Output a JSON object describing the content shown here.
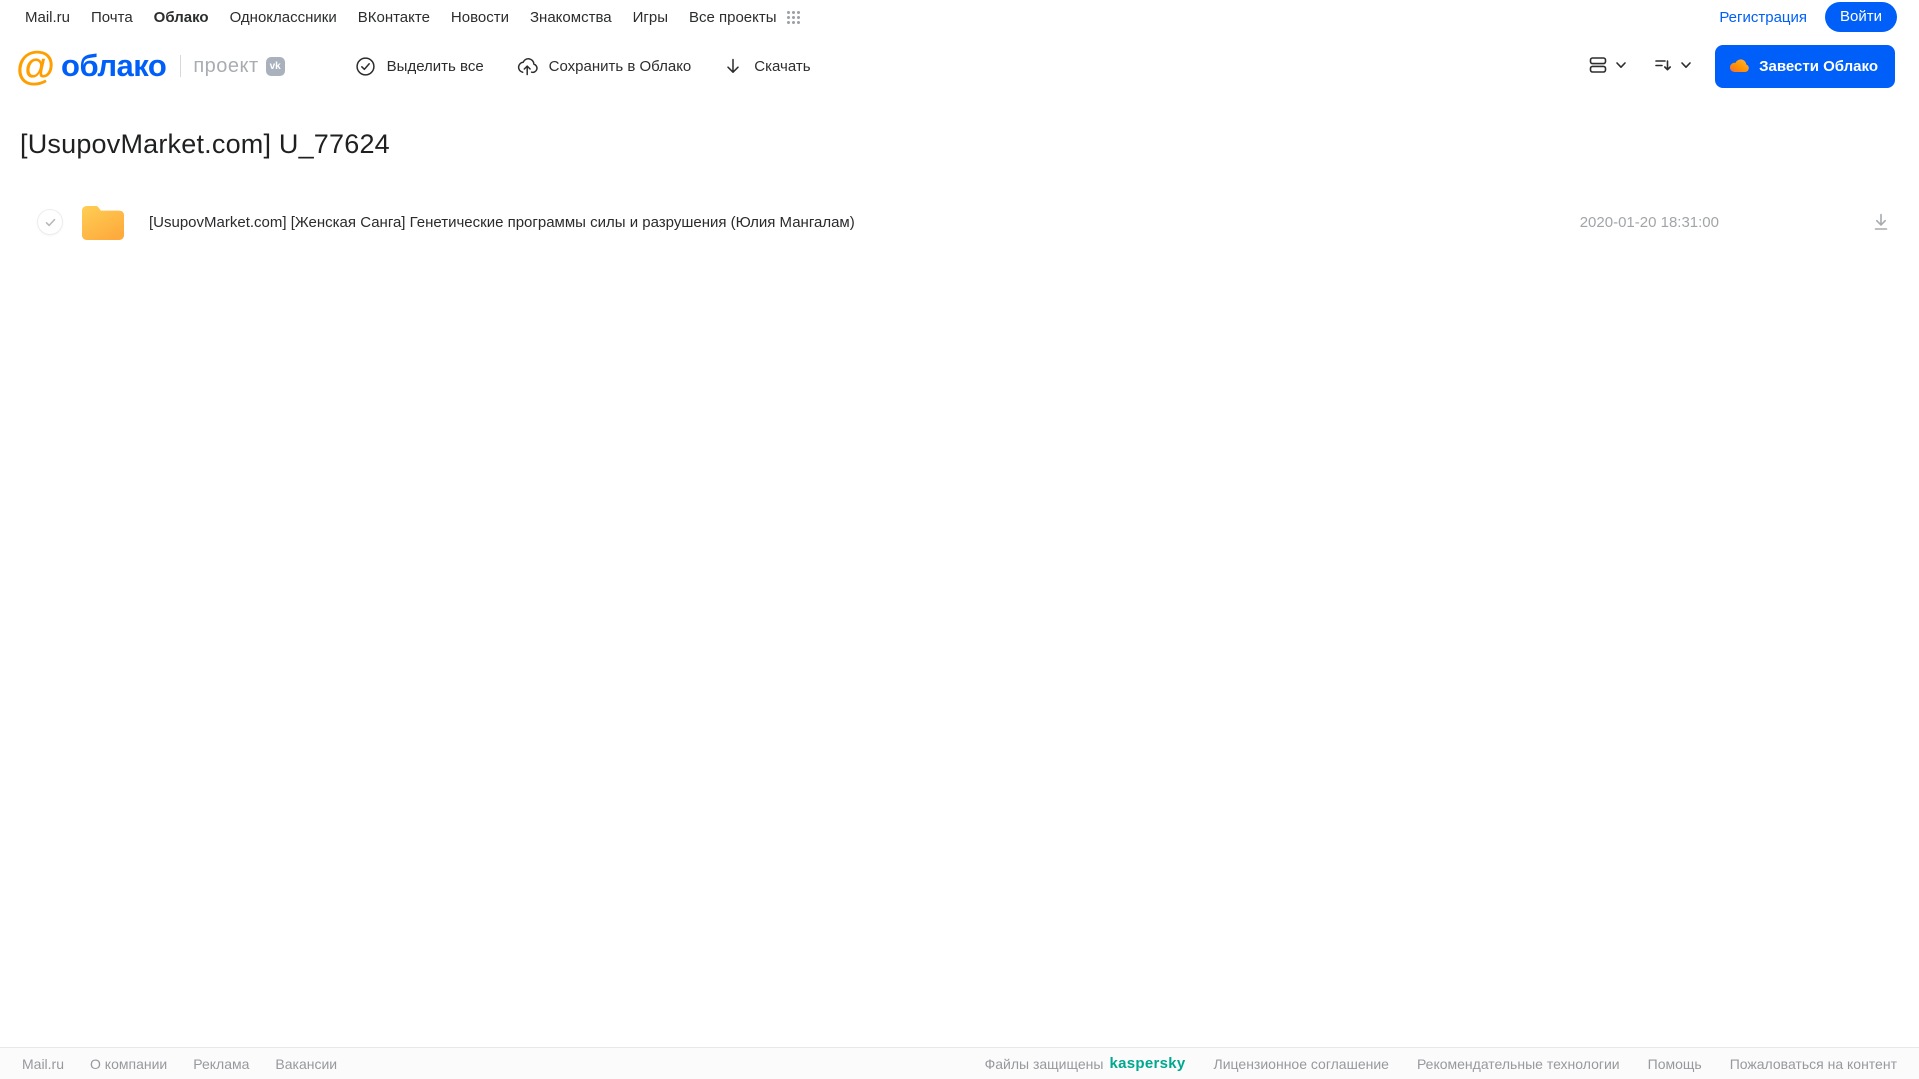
{
  "topnav": {
    "items": [
      "Mail.ru",
      "Почта",
      "Облако",
      "Одноклассники",
      "ВКонтакте",
      "Новости",
      "Знакомства",
      "Игры",
      "Все проекты"
    ],
    "active_item": "Облако",
    "registration_label": "Регистрация",
    "login_label": "Войти"
  },
  "header": {
    "logo_at": "@",
    "logo_text": "облако",
    "project_label": "проект",
    "vk_badge": "vk",
    "toolbar": {
      "select_all_label": "Выделить все",
      "save_to_cloud_label": "Сохранить в Облако",
      "download_label": "Скачать"
    },
    "get_cloud_label": "Завести Облако"
  },
  "main": {
    "title": "[UsupovMarket.com] U_77624",
    "files": [
      {
        "type": "folder",
        "name": "[UsupovMarket.com] [Женская Санга] Генетические программы силы и разрушения (Юлия Мангалам)",
        "date": "2020-01-20 18:31:00"
      }
    ]
  },
  "footer": {
    "links_left": [
      "Mail.ru",
      "О компании",
      "Реклама",
      "Вакансии"
    ],
    "protected_prefix": "Файлы защищены",
    "kaspersky": "kaspersky",
    "links_right": [
      "Лицензионное соглашение",
      "Рекомендательные технологии",
      "Помощь",
      "Пожаловаться на контент"
    ]
  },
  "colors": {
    "accent_blue": "#005ff9",
    "logo_orange": "#ff9e00",
    "kaspersky_teal": "#00a88e",
    "folder_gradient_top": "#ffce55",
    "folder_gradient_bottom": "#fdab3d"
  }
}
